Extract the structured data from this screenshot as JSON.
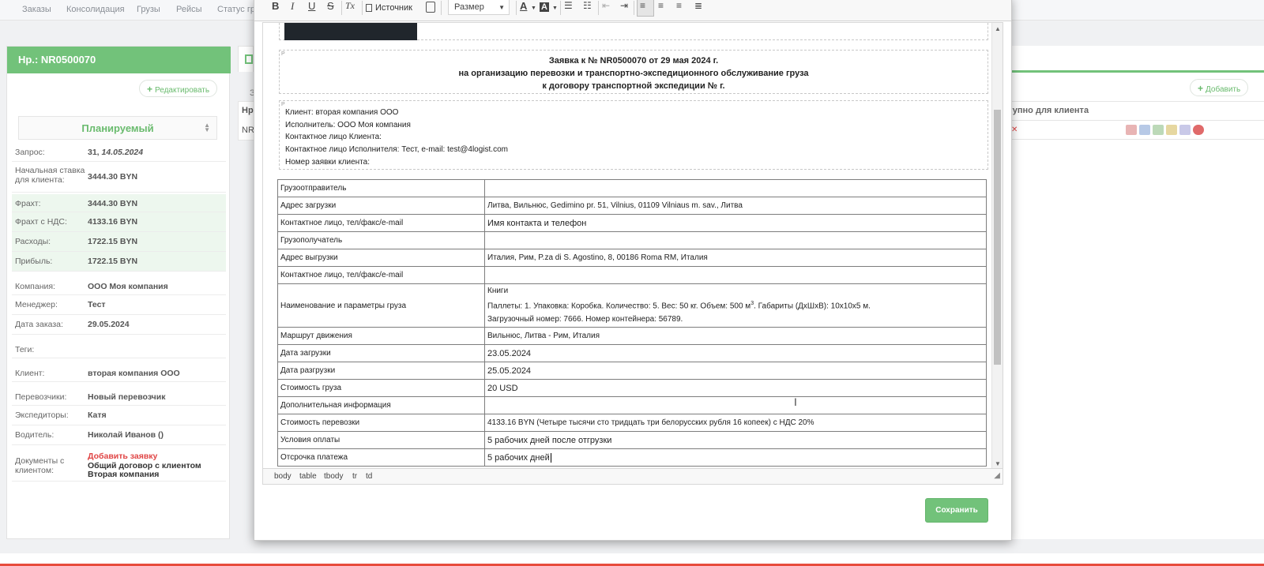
{
  "topnav": {
    "items": [
      "Заказы",
      "Консолидация",
      "Грузы",
      "Рейсы",
      "Статус гру"
    ]
  },
  "order": {
    "header": "Нр.: NR0500070",
    "edit_label": "Редактировать",
    "status": "Планируемый",
    "rows": {
      "request_label": "Запрос:",
      "request_value": "31, ",
      "request_date": "14.05.2024",
      "start_rate_label": "Начальная ставка для клиента:",
      "start_rate_value": "3444.30 BYN",
      "freight_label": "Фрахт:",
      "freight_value": "3444.30 BYN",
      "freight_vat_label": "Фрахт с НДС:",
      "freight_vat_value": "4133.16 BYN",
      "expenses_label": "Расходы:",
      "expenses_value": "1722.15 BYN",
      "profit_label": "Прибыль:",
      "profit_value": "1722.15 BYN",
      "company_label": "Компания:",
      "company_value": "ООО Моя компания",
      "manager_label": "Менеджер:",
      "manager_value": "Тест",
      "order_date_label": "Дата заказа:",
      "order_date_value": "29.05.2024",
      "tags_label": "Теги:",
      "client_label": "Клиент:",
      "client_value": "вторая компания ООО",
      "carriers_label": "Перевозчики:",
      "carriers_value": "Новый перевозчик",
      "forwarders_label": "Экспедиторы:",
      "forwarders_value": "Катя",
      "driver_label": "Водитель:",
      "driver_value": "Николай Иванов ()",
      "docs_label": "Документы с клиентом:",
      "docs_add": "Добавить заявку",
      "docs_item1": "Общий договор с клиентом",
      "docs_item2": "Вторая компания"
    }
  },
  "middle": {
    "th": "Нр.",
    "td": "NR",
    "z": "З"
  },
  "right": {
    "add_label": "Добавить",
    "th": "ступно для клиента"
  },
  "editor": {
    "toolbar": {
      "bold": "B",
      "italic": "I",
      "underline": "U",
      "strike": "S",
      "clear": "Tx",
      "source": "Источник",
      "size": "Размер",
      "font_color": "A",
      "bg_color": "A"
    },
    "title_lines": [
      "Заявка к № NR0500070 от 29 мая 2024 г.",
      "на организацию перевозки и транспортно-экспедиционного обслуживание груза",
      "к договору транспортной экспедиции №  г."
    ],
    "p_mark": "P",
    "client_lines": [
      "Клиент: вторая компания ООО",
      "Исполнитель: ООО Моя компания",
      "Контактное лицо Клиента:",
      "Контактное лицо Исполнителя: Тест, e-mail: test@4logist.com",
      "Номер заявки клиента:"
    ],
    "table": [
      {
        "k": "Грузоотправитель",
        "v": ""
      },
      {
        "k": "Адрес загрузки",
        "v": "Литва, Вильнюс, Gedimino pr. 51, Vilnius, 01109 Vilniaus m. sav., Литва"
      },
      {
        "k": "Контактное лицо, тел/факс/e-mail",
        "v": "Имя контакта и телефон"
      },
      {
        "k": "Грузополучатель",
        "v": ""
      },
      {
        "k": "Адрес выгрузки",
        "v": "Италия, Рим, P.za di S. Agostino, 8, 00186 Roma RM, Италия"
      },
      {
        "k": "Контактное лицо, тел/факс/e-mail",
        "v": ""
      },
      {
        "k": "Наименование и параметры груза",
        "v1": "Книги",
        "v2": "Паллеты: 1.  Упаковка: Коробка.  Количество: 5.  Вес: 50 кг.  Объем: 500 м",
        "v2_sup": "3",
        "v2_end": ".  Габариты (ДхШхВ): 10х10х5 м.",
        "v3": "Загрузочный номер: 7666.  Номер контейнера: 56789."
      },
      {
        "k": "Маршрут движения",
        "v": "Вильнюс, Литва - Рим, Италия"
      },
      {
        "k": "Дата загрузки",
        "v": "23.05.2024"
      },
      {
        "k": "Дата разгрузки",
        "v": "25.05.2024"
      },
      {
        "k": "Стоимость груза",
        "v": "20 USD"
      },
      {
        "k": "Дополнительная информация",
        "v": ""
      },
      {
        "k": "Стоимость перевозки",
        "v": "4133.16 BYN (Четыре тысячи сто тридцать три белорусских рубля 16 копеек) с НДС 20%"
      },
      {
        "k": "Условия оплаты",
        "v": "5 рабочих дней после отгрузки"
      },
      {
        "k": "Отсрочка платежа",
        "v": "5 рабочих дней"
      }
    ],
    "statusbar": [
      "body",
      "table",
      "tbody",
      "tr",
      "td"
    ],
    "save_label": "Сохранить"
  },
  "colors": {
    "accent_green": "#72c27a",
    "link_red": "#e04545",
    "dark_block": "#20262c"
  }
}
